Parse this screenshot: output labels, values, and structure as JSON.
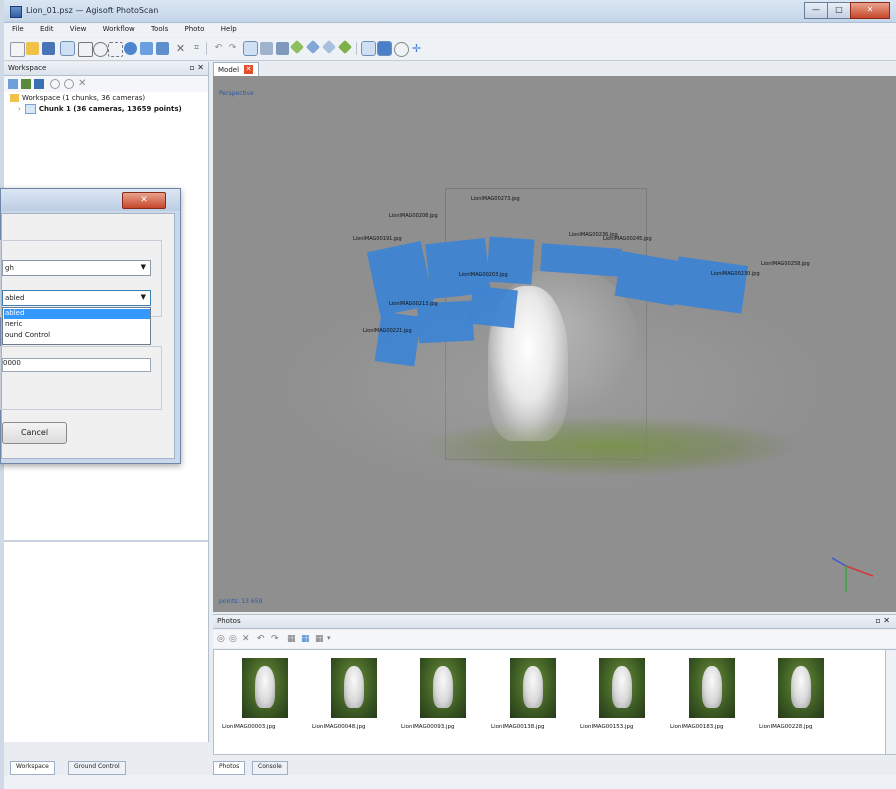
{
  "window": {
    "title": "Lion_01.psz — Agisoft PhotoScan",
    "controls": [
      "—",
      "□",
      "✕"
    ]
  },
  "menu": [
    "File",
    "Edit",
    "View",
    "Workflow",
    "Tools",
    "Photo",
    "Help"
  ],
  "workspace": {
    "pane_title": "Workspace",
    "pane_controls": "▫ ✕",
    "root": "Workspace (1 chunks, 36 cameras)",
    "chunk": "Chunk 1 (36 cameras, 13659 points)"
  },
  "left_tabs": [
    "Workspace",
    "Ground Control"
  ],
  "model": {
    "tab_label": "Model",
    "perspective_label": "Perspective",
    "points_label": "points: 13 659",
    "camera_labels": [
      "LionIMAG00273.jpg",
      "LionIMAG00208.jpg",
      "LionIMAG00191.jpg",
      "LionIMAG00213.jpg",
      "LionIMAG00203.jpg",
      "LionIMAG00221.jpg",
      "LionIMAG00236.jpg",
      "LionIMAG00245.jpg",
      "LionIMAG00258.jpg",
      "LionIMAG00230.jpg"
    ]
  },
  "photos": {
    "pane_title": "Photos",
    "pane_controls": "▫ ✕",
    "items": [
      {
        "label": "LionIMAG00003.jpg"
      },
      {
        "label": "LionIMAG00048.jpg"
      },
      {
        "label": "LionIMAG00093.jpg"
      },
      {
        "label": "LionIMAG00138.jpg"
      },
      {
        "label": "LionIMAG00153.jpg"
      },
      {
        "label": "LionIMAG00183.jpg"
      },
      {
        "label": "LionIMAG00228.jpg"
      }
    ]
  },
  "bottom_tabs": [
    "Photos",
    "Console"
  ],
  "dialog": {
    "close": "✕",
    "accuracy_value": "gh",
    "pair_preselection_value": "abled",
    "dropdown_options": [
      "abled",
      "neric",
      "ound Control"
    ],
    "points_field": "0000",
    "cancel_label": "Cancel"
  },
  "colors": {
    "camera_blue": "#3f84d2",
    "viewport_bg": "#8f8f8f",
    "selection": "#3399ff",
    "close_red": "#c7472b"
  }
}
